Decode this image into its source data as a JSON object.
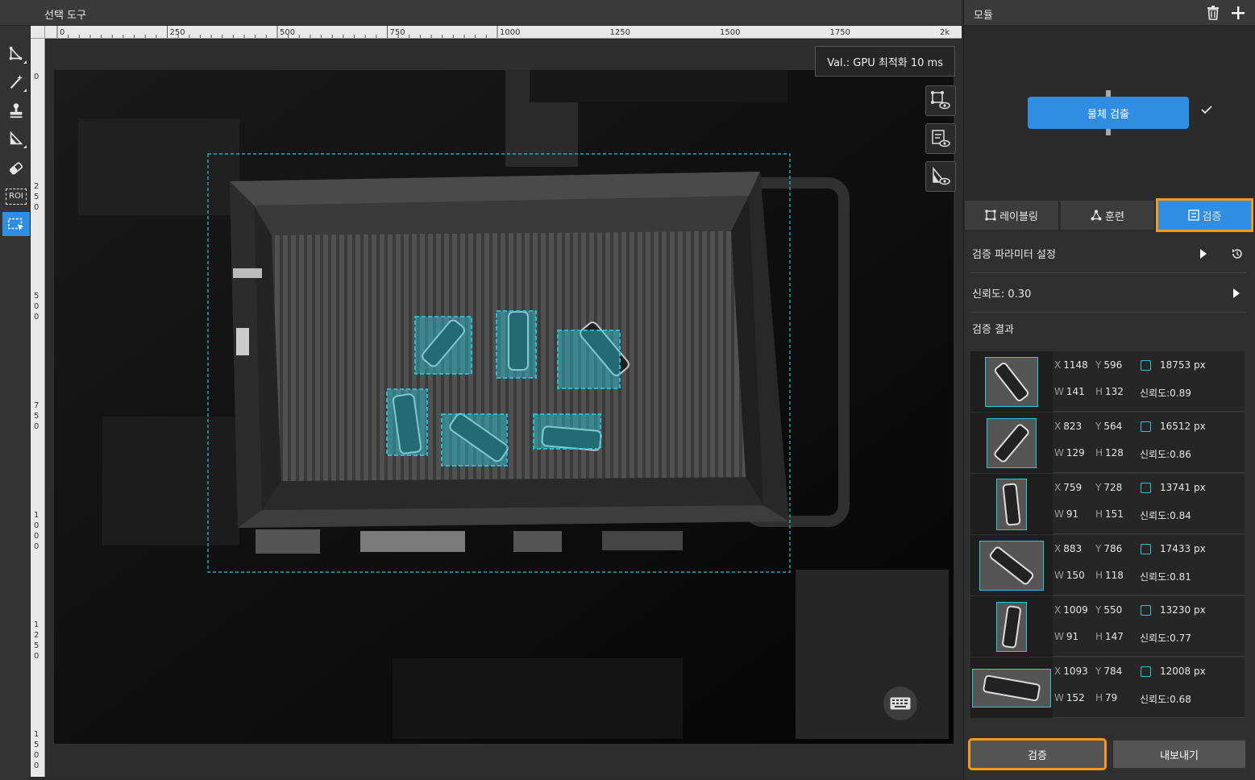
{
  "tool_panel": {
    "title": "선택 도구"
  },
  "hruler": {
    "labels": [
      "0",
      "250",
      "500",
      "750",
      "1000",
      "1250",
      "1500",
      "1750",
      "2k"
    ]
  },
  "vruler": {
    "labels": [
      [
        "0"
      ],
      [
        "2",
        "5",
        "0"
      ],
      [
        "5",
        "0",
        "0"
      ],
      [
        "7",
        "5",
        "0"
      ],
      [
        "1",
        "0",
        "0",
        "0"
      ],
      [
        "1",
        "2",
        "5",
        "0"
      ],
      [
        "1",
        "5",
        "0",
        "0"
      ]
    ]
  },
  "toolbar": {
    "roi_label": "ROI"
  },
  "canvas": {
    "val_text": "Val.:  GPU 최적화 10 ms"
  },
  "module_panel": {
    "title": "모듈",
    "module_name": "물체 검출"
  },
  "tabs": {
    "labeling": "레이블링",
    "training": "훈련",
    "validation": "검증"
  },
  "validation": {
    "param_label": "검증 파라미터 설정",
    "confidence_label": "신뢰도: 0.30",
    "results_label": "검증 결과",
    "results": [
      {
        "x": "1148",
        "y": "596",
        "w": "141",
        "h": "132",
        "area": "18753 px",
        "conf": "신뢰도:0.89"
      },
      {
        "x": "823",
        "y": "564",
        "w": "129",
        "h": "128",
        "area": "16512 px",
        "conf": "신뢰도:0.86"
      },
      {
        "x": "759",
        "y": "728",
        "w": "91",
        "h": "151",
        "area": "13741 px",
        "conf": "신뢰도:0.84"
      },
      {
        "x": "883",
        "y": "786",
        "w": "150",
        "h": "118",
        "area": "17433 px",
        "conf": "신뢰도:0.81"
      },
      {
        "x": "1009",
        "y": "550",
        "w": "91",
        "h": "147",
        "area": "13230 px",
        "conf": "신뢰도:0.77"
      },
      {
        "x": "1093",
        "y": "784",
        "w": "152",
        "h": "79",
        "area": "12008 px",
        "conf": "신뢰도:0.68"
      }
    ],
    "keys": {
      "x": "X",
      "y": "Y",
      "w": "W",
      "h": "H"
    }
  },
  "buttons": {
    "validate": "검증",
    "export": "내보내기"
  },
  "colors": {
    "accent": "#2f8de4",
    "highlight": "#f39a1e",
    "detection": "#29c6d6"
  }
}
